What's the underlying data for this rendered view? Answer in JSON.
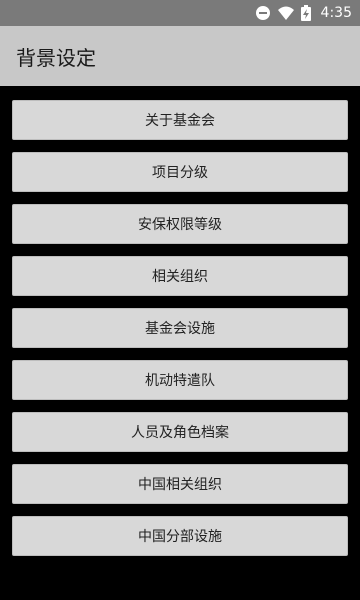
{
  "status_bar": {
    "time": "4:35",
    "icons": [
      "minus-circle-icon",
      "wifi-icon",
      "battery-charging-icon"
    ]
  },
  "app_bar": {
    "title": "背景设定"
  },
  "menu": {
    "items": [
      {
        "label": "关于基金会"
      },
      {
        "label": "项目分级"
      },
      {
        "label": "安保权限等级"
      },
      {
        "label": "相关组织"
      },
      {
        "label": "基金会设施"
      },
      {
        "label": "机动特遣队"
      },
      {
        "label": "人员及角色档案"
      },
      {
        "label": "中国相关组织"
      },
      {
        "label": "中国分部设施"
      }
    ]
  },
  "colors": {
    "status_bar": "#7a7a7a",
    "app_bar": "#c8c8c8",
    "background": "#000000",
    "button": "#d8d8d8"
  }
}
